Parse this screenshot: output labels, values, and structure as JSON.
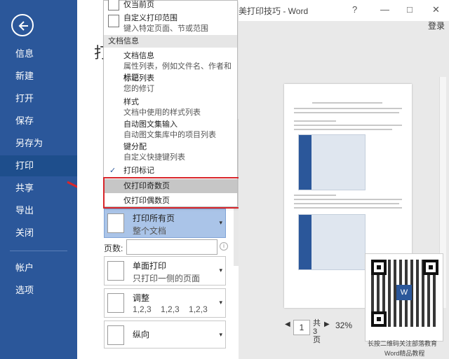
{
  "window": {
    "title": "技巧 - Word",
    "title_full": "美打印技巧 - Word",
    "help": "?",
    "minimize": "—",
    "maximize": "□",
    "close": "✕",
    "login": "登录"
  },
  "nav": {
    "items": [
      {
        "label": "信息"
      },
      {
        "label": "新建"
      },
      {
        "label": "打开"
      },
      {
        "label": "保存"
      },
      {
        "label": "另存为"
      },
      {
        "label": "打印"
      },
      {
        "label": "共享"
      },
      {
        "label": "导出"
      },
      {
        "label": "关闭"
      },
      {
        "label": "帐户"
      },
      {
        "label": "选项"
      }
    ],
    "active": "打印"
  },
  "dropdown": {
    "top_item": {
      "title": "仅当前页"
    },
    "custom_range": {
      "title": "自定义打印范围",
      "desc": "键入特定页面、节或范围"
    },
    "section_header": "文档信息",
    "doc_items": [
      {
        "title": "文档信息",
        "desc": "属性列表，例如文件名、作者和标题"
      },
      {
        "title": "标记列表",
        "desc": "您的修订"
      },
      {
        "title": "样式",
        "desc": "文档中使用的样式列表"
      },
      {
        "title": "自动图文集输入",
        "desc": "自动图文集库中的项目列表"
      },
      {
        "title": "键分配",
        "desc": "自定义快捷键列表"
      }
    ],
    "print_markup": "打印标记",
    "odd_pages": "仅打印奇数页",
    "even_pages": "仅打印偶数页",
    "check_mark": "✓"
  },
  "settings": {
    "print_all": {
      "title": "打印所有页",
      "desc": "整个文档"
    },
    "pages_label": "页数:",
    "pages_value": "",
    "single_sided": {
      "title": "单面打印",
      "desc": "只打印一侧的页面"
    },
    "collate": {
      "title": "调整",
      "desc": "1,2,3    1,2,3    1,2,3"
    },
    "orientation": {
      "title": "纵向"
    },
    "dropdown_arrow": "▾"
  },
  "preview": {
    "page_current": "1",
    "page_of": "共",
    "page_total": "3",
    "page_unit": "页",
    "zoom": "32%",
    "prev": "◀",
    "next": "▶"
  },
  "qr": {
    "caption_line1": "长按二维码关注部落教育",
    "caption_line2": "Word精品教程",
    "logo": "W"
  },
  "colors": {
    "nav_blue": "#2b579a",
    "highlight_red": "#d9262b",
    "selected_blue": "#aac4e8"
  }
}
